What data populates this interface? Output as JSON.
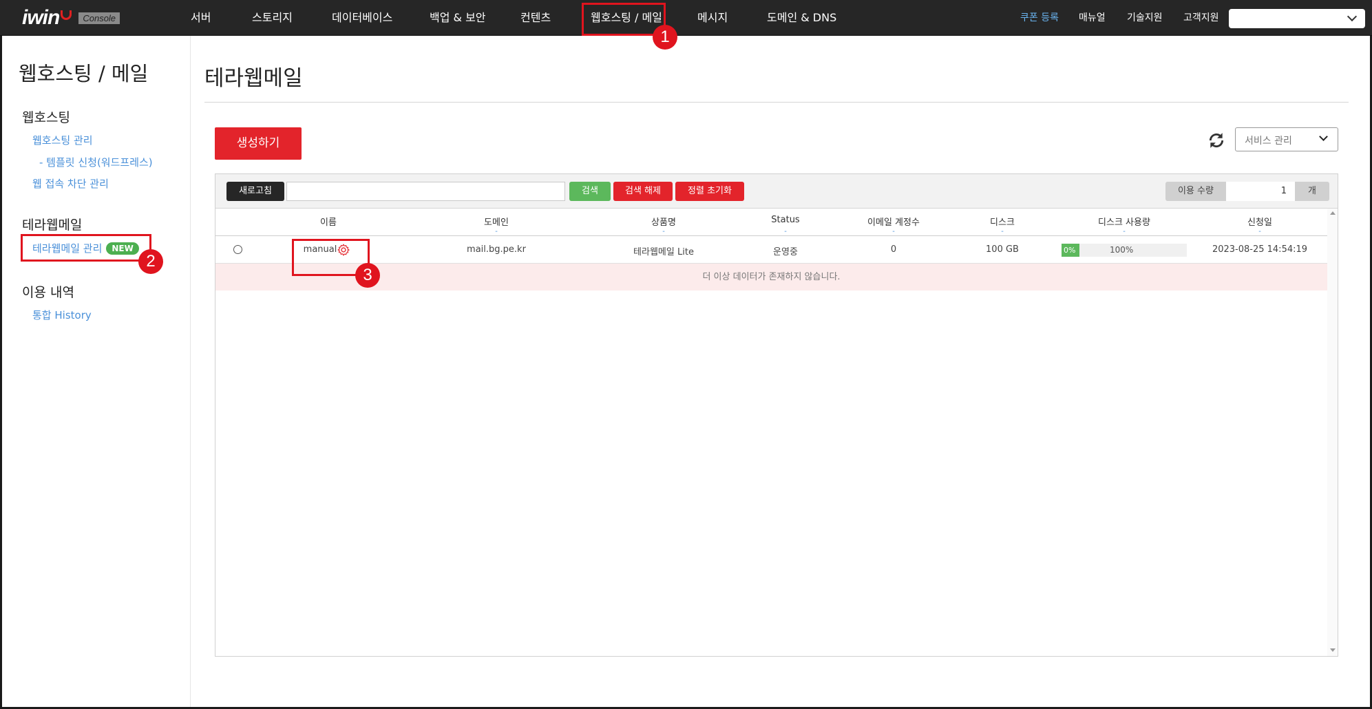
{
  "topnav": {
    "logo": "iwin",
    "console": "Console",
    "items": [
      "서버",
      "스토리지",
      "데이터베이스",
      "백업 & 보안",
      "컨텐츠",
      "웹호스팅 / 메일",
      "메시지",
      "도메인 & DNS"
    ],
    "right": [
      "쿠폰 등록",
      "매뉴얼",
      "기술지원",
      "고객지원"
    ],
    "select_value": "",
    "accent_color": "#6ab4f0"
  },
  "annotations": [
    "1",
    "2",
    "3"
  ],
  "sidebar": {
    "title": "웹호스팅 / 메일",
    "sections": [
      {
        "title": "웹호스팅",
        "links": [
          "웹호스팅 관리",
          "- 템플릿 신청(워드프레스)",
          "웹 접속 차단 관리"
        ]
      },
      {
        "title": "테라웹메일",
        "links": [
          "테라웹메일 관리"
        ],
        "badge": "NEW"
      },
      {
        "title": "이용 내역",
        "links": [
          "통합 History"
        ]
      }
    ]
  },
  "main": {
    "title": "테라웹메일",
    "create_button": "생성하기",
    "service_select": "서비스 관리",
    "toolbar": {
      "refresh": "새로고침",
      "search_value": "",
      "search": "검색",
      "clear_search": "검색 해제",
      "reset_sort": "정렬 초기화",
      "usage_label": "이용 수량",
      "usage_value": "1",
      "usage_unit": "개"
    },
    "columns": [
      "이름",
      "도메인",
      "상품명",
      "Status",
      "이메일 계정수",
      "디스크",
      "디스크 사용량",
      "신청일"
    ],
    "column_dash": "-",
    "rows": [
      {
        "name": "manual",
        "domain": "mail.bg.pe.kr",
        "product": "테라웹메일 Lite",
        "status": "운영중",
        "accounts": "0",
        "disk": "100 GB",
        "usage_percent": 0,
        "usage_label": "0%",
        "usage_total": "100%",
        "date": "2023-08-25 14:54:19"
      }
    ],
    "empty_message": "더 이상 데이터가 존재하지 않습니다.",
    "colors": {
      "red": "#e3242b",
      "green": "#5cb85c",
      "dark": "#262626",
      "link": "#4a90d9"
    }
  }
}
